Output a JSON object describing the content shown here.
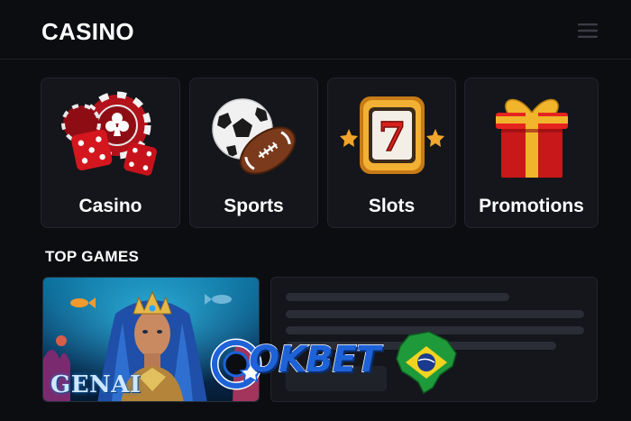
{
  "header": {
    "title": "CASINO",
    "menu_icon": "hamburger-menu-icon"
  },
  "categories": [
    {
      "label": "Casino",
      "icon": "casino-chips-dice-icon"
    },
    {
      "label": "Sports",
      "icon": "soccer-football-icon"
    },
    {
      "label": "Slots",
      "icon": "slot-machine-seven-icon"
    },
    {
      "label": "Promotions",
      "icon": "gift-box-icon"
    }
  ],
  "top_games": {
    "title": "TOP GAMES",
    "games": [
      {
        "name": "GENAI"
      }
    ]
  },
  "watermark": {
    "text": "OKBET",
    "flag_icon": "brazil-map-flag-icon"
  },
  "colors": {
    "background": "#0c0d11",
    "card": "#14161b",
    "card_border": "#22252c",
    "watermark_blue": "#1e62d8"
  }
}
